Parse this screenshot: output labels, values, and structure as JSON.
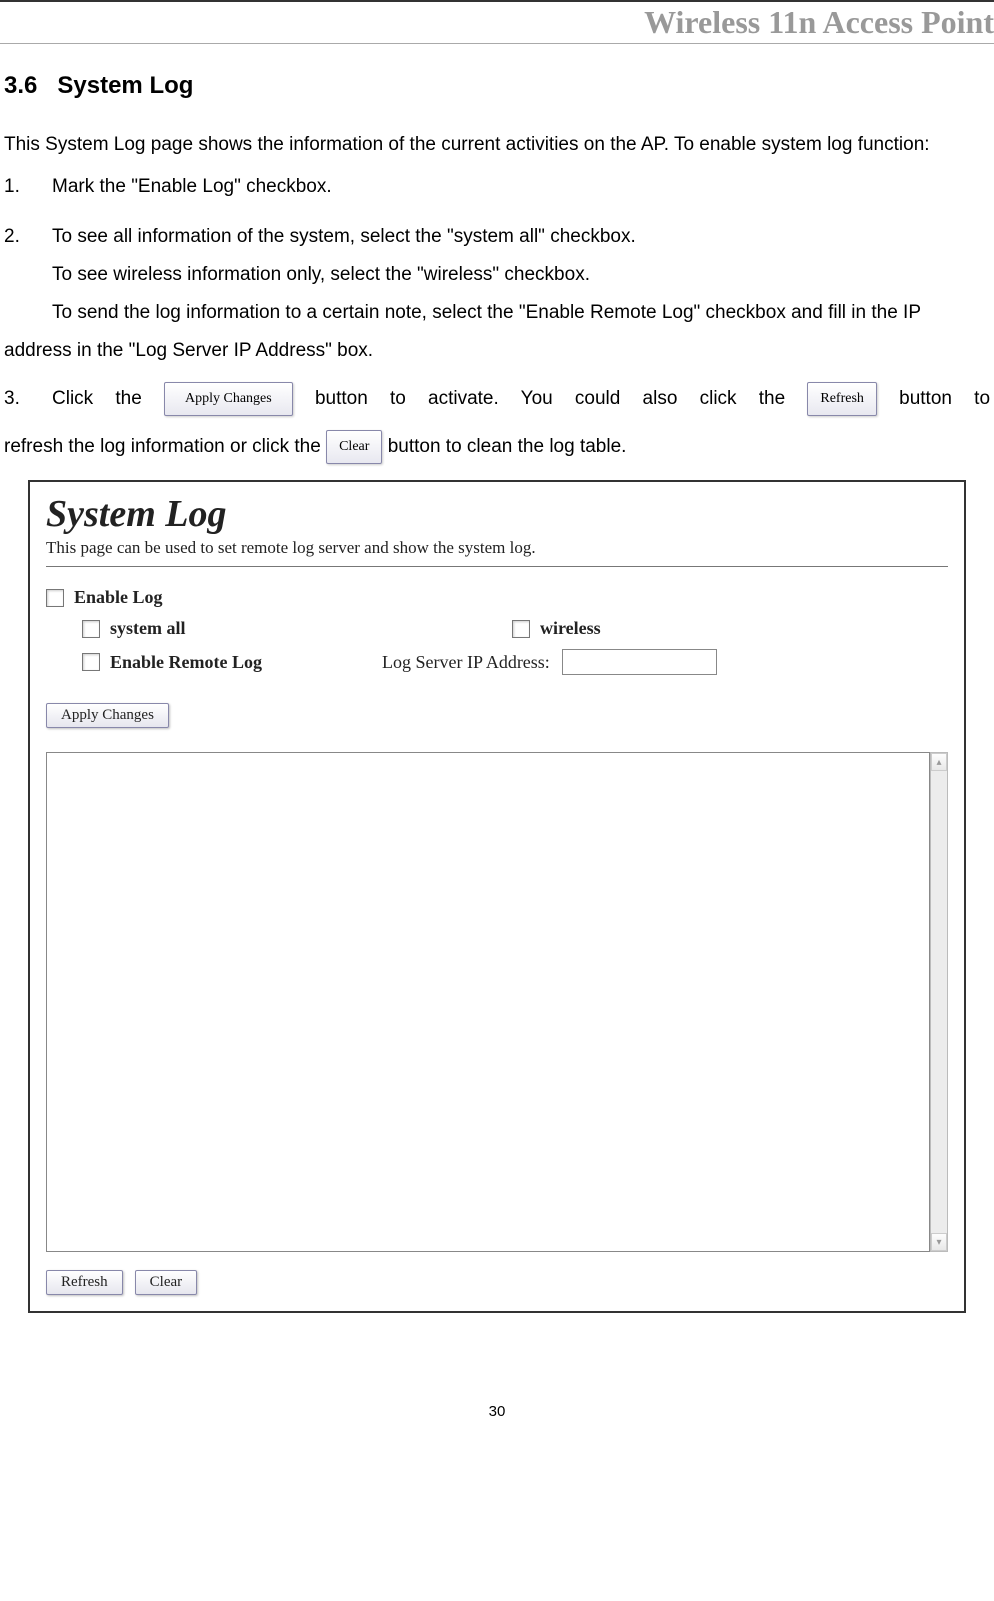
{
  "header": {
    "title": "Wireless 11n Access Point"
  },
  "section": {
    "number": "3.6",
    "title": "System Log"
  },
  "intro": "This System Log page shows the information of the current activities on the AP. To enable system log function:",
  "steps": {
    "s1_num": "1.",
    "s1": "Mark the \"Enable Log\" checkbox.",
    "s2_num": "2.",
    "s2": "To see all information of the system, select the \"system all\" checkbox.",
    "s2b": "To see wireless information only, select the \"wireless\" checkbox.",
    "s2c": "To send the log information to a certain note, select the \"Enable Remote Log\" checkbox and fill in the IP address in the \"Log Server IP Address\" box.",
    "s3_num": "3.",
    "s3_a": "Click the ",
    "s3_apply": "Apply Changes",
    "s3_b": " button to activate. You could also click the ",
    "s3_refresh": "Refresh",
    "s3_c": " button to",
    "s3_d": "refresh the log information or click the ",
    "s3_clear": "Clear",
    "s3_e": " button to clean the log table."
  },
  "screenshot": {
    "title": "System Log",
    "desc": "This page can be used to set remote log server and show the system log.",
    "enable_log": "Enable Log",
    "system_all": "system all",
    "wireless": "wireless",
    "enable_remote": "Enable Remote Log",
    "log_server_label": "Log Server IP Address:",
    "apply": "Apply Changes",
    "refresh": "Refresh",
    "clear": "Clear"
  },
  "page_number": "30"
}
